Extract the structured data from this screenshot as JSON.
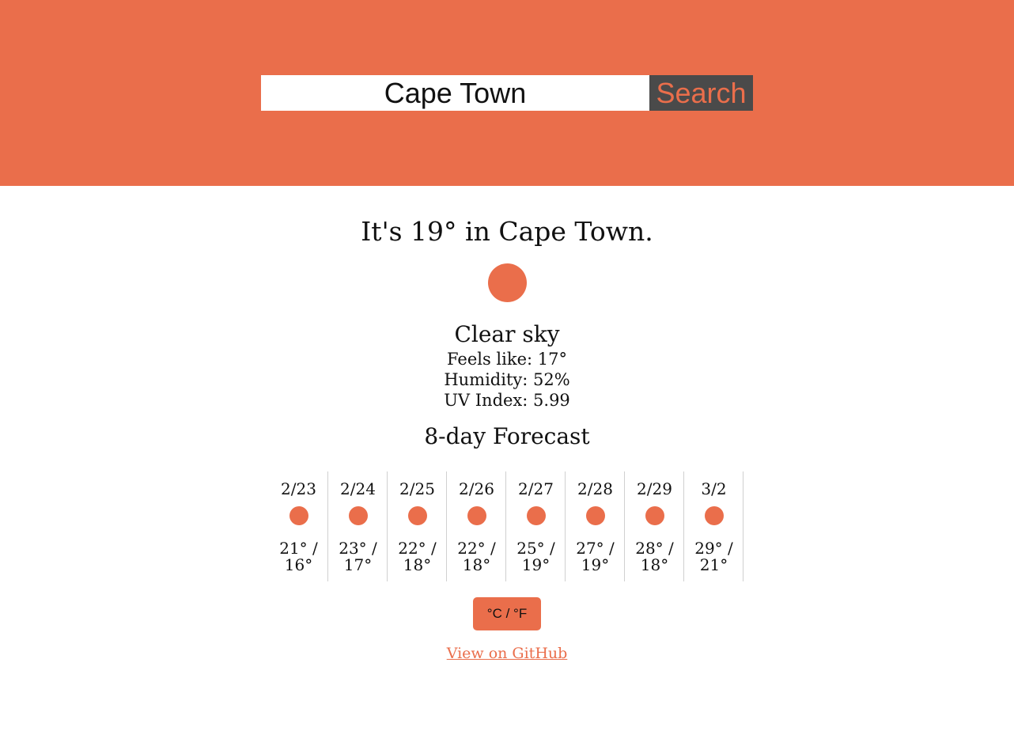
{
  "colors": {
    "accent": "#EA6E4B",
    "button_bg": "#4a4a4a",
    "text": "#111111"
  },
  "search": {
    "value": "Cape Town",
    "button_label": "Search"
  },
  "current": {
    "title": "It's 19° in Cape Town.",
    "icon": "sun-icon",
    "condition": "Clear sky",
    "feels_like": "Feels like: 17°",
    "humidity": "Humidity: 52%",
    "uv_index": "UV Index: 5.99"
  },
  "forecast": {
    "title": "8-day Forecast",
    "days": [
      {
        "date": "2/23",
        "icon": "sun-icon",
        "temps": "21° / 16°"
      },
      {
        "date": "2/24",
        "icon": "sun-icon",
        "temps": "23° / 17°"
      },
      {
        "date": "2/25",
        "icon": "sun-icon",
        "temps": "22° / 18°"
      },
      {
        "date": "2/26",
        "icon": "sun-icon",
        "temps": "22° / 18°"
      },
      {
        "date": "2/27",
        "icon": "sun-icon",
        "temps": "25° / 19°"
      },
      {
        "date": "2/28",
        "icon": "sun-icon",
        "temps": "27° / 19°"
      },
      {
        "date": "2/29",
        "icon": "sun-icon",
        "temps": "28° / 18°"
      },
      {
        "date": "3/2",
        "icon": "sun-icon",
        "temps": "29° / 21°"
      }
    ]
  },
  "unit_toggle_label": "°C / °F",
  "github_link_label": "View on GitHub"
}
